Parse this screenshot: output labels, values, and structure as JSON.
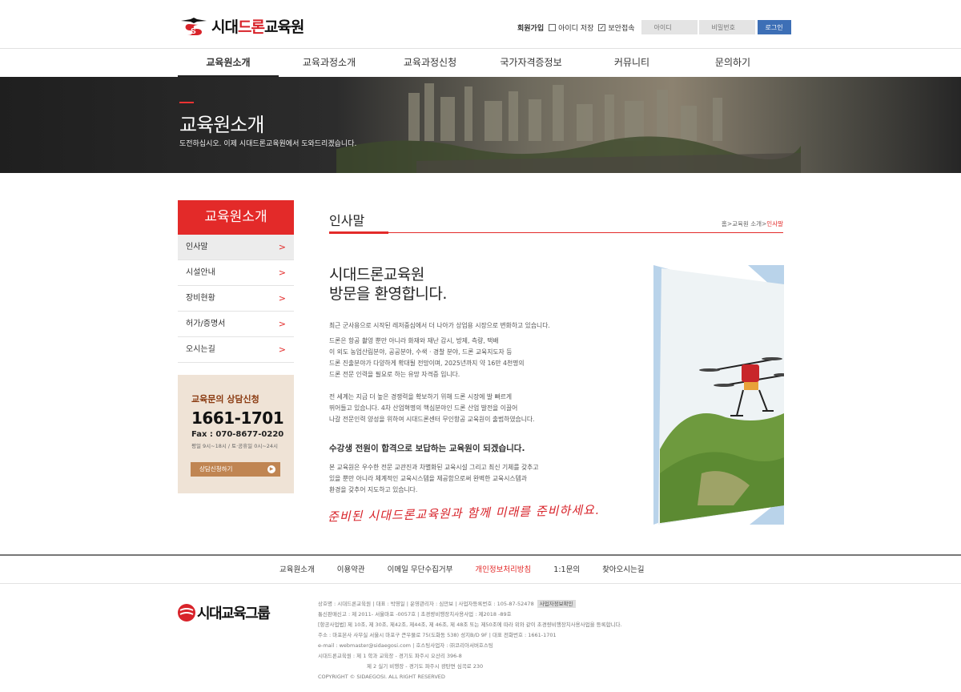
{
  "header": {
    "logo_prefix": "시대",
    "logo_highlight": "드론",
    "logo_suffix": "교육원",
    "join": "회원가입",
    "save_id": "아이디 저장",
    "secure": "보안접속",
    "id_placeholder": "아이디",
    "pw_placeholder": "비밀번호",
    "login": "로그인"
  },
  "nav": [
    "교육원소개",
    "교육과정소개",
    "교육과정신청",
    "국가자격증정보",
    "커뮤니티",
    "문의하기"
  ],
  "banner": {
    "title": "교육원소개",
    "subtitle": "도전하십시오. 이제 시대드론교육원에서 도와드리겠습니다."
  },
  "sidebar": {
    "title": "교육원소개",
    "items": [
      {
        "label": "인사말"
      },
      {
        "label": "시설안내"
      },
      {
        "label": "장비현황"
      },
      {
        "label": "허가/증명서"
      },
      {
        "label": "오시는길"
      }
    ],
    "arrow": ">"
  },
  "consult": {
    "title": "교육문의 상담신청",
    "tel": "1661-1701",
    "fax": "Fax : 070-8677-0220",
    "hours": "평일 9시~18시 / 토·공휴일 0시~24시",
    "button": "상담신청하기",
    "button_icon": "▶"
  },
  "content": {
    "title": "인사말",
    "breadcrumb": {
      "home": "홈",
      "sep": ">",
      "section": "교육원 소개",
      "current": "인사말"
    },
    "welcome1": "시대드론교육원",
    "welcome2": "방문을 환영합니다.",
    "p1": "최근 군사용으로 시작된 레저중심에서 더 나아가 상업용 시장으로 변화하고 있습니다.",
    "p2": [
      "드론은 항공 촬영 뿐만 아니라 화재와 재난 감시, 방제, 측량, 택배",
      "이 외도 농업산림분야, 공공분야, 수색 · 경찰 분야, 드론 교육지도자 등",
      "드론 진출분야가 다양하게 확대될 전망이며, 2025년까지 약 16만 4천명의",
      "드론 전문 인력을 필요로 하는 유망 자격증 입니다."
    ],
    "p3": [
      "전 세계는 지금 더 높은 경쟁력을 확보하기 위해 드론 시장에 발 빠르게",
      "뛰어들고 있습니다. 4차 산업혁명의 핵심분야인 드론 산업 발전을 이끌어",
      "나갈 전문인력 양성을 위하여 시대드론센터 무인항공 교육원이 출범하였습니다."
    ],
    "heading": "수강생 전원이 합격으로 보답하는 교육원이 되겠습니다.",
    "p4": [
      "본 교육원은 우수한 전문 교관진과 차별화된 교육시설 그리고 최신 기체를 갖추고",
      "있을 뿐만 아니라 체계적인 교육시스템을 제공함으로써 완벽한 교육시스템과",
      "환경을 갖추어 지도하고 있습니다."
    ],
    "signature": "준비된 시대드론교육원과 함께 미래를 준비하세요."
  },
  "footer": {
    "links": [
      "교육원소개",
      "이용약관",
      "이메일 무단수집거부",
      "개인정보처리방침",
      "1:1문의",
      "찾아오시는길"
    ],
    "logo_text": "시대교육그룹",
    "info": [
      "상호명 : 시대드론교육원 | 대표 : 박영일 | 운영관리자 : 심만보 | 사업자등록번호 : 105-87-52478",
      "통신판매신고 : 제 2011- 서울마포 -0057호 | 초경량비행장치사용사업 : 제2018 -89호",
      "[항공사업법] 제 10조, 제 30조, 제42조, 제44조, 제 46조, 제 48조 또는 제50조에 따라 위와 같이 초경량비행장치사용사업을 등록합니다.",
      "주소 : 마포본사 사무실 서울시 마포구 큰우물로 75(도화동 538) 성지B/D 9F | 대표 전화번호 : 1661-1701",
      "e-mail : webmaster@sidaegosi.com | 호스팅사업자 : ㈜코리아서버호스팅",
      "시대드론교육원 : 제 1 학과 교육장 - 경기도 파주시 오산리 396-8",
      "제 2 실기 비행장 - 경기도 파주시 광탄면 심곡로 230",
      "COPYRIGHT © SIDAEGOSI. ALL RIGHT RESERVED"
    ],
    "biz_tag": "사업자정보확인"
  }
}
